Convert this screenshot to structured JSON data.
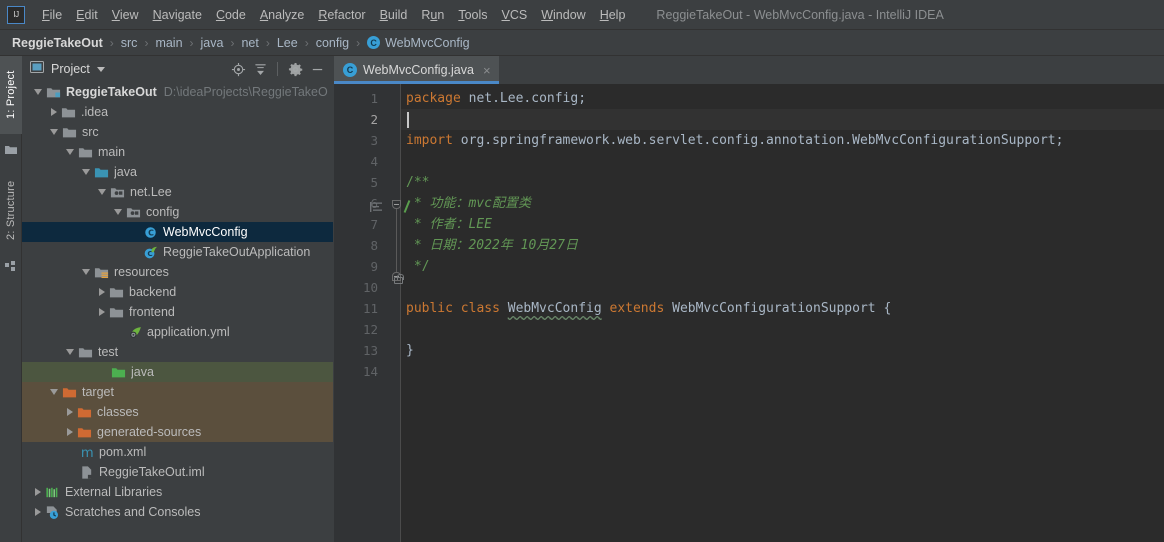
{
  "window": {
    "title": "ReggieTakeOut - WebMvcConfig.java - IntelliJ IDEA",
    "logo": "IJ"
  },
  "menubar": {
    "items": [
      {
        "label": "File",
        "mnemonic": "F"
      },
      {
        "label": "Edit",
        "mnemonic": "E"
      },
      {
        "label": "View",
        "mnemonic": "V"
      },
      {
        "label": "Navigate",
        "mnemonic": "N"
      },
      {
        "label": "Code",
        "mnemonic": "C"
      },
      {
        "label": "Analyze",
        "mnemonic": "A"
      },
      {
        "label": "Refactor",
        "mnemonic": "R"
      },
      {
        "label": "Build",
        "mnemonic": "B"
      },
      {
        "label": "Run",
        "mnemonic": "u"
      },
      {
        "label": "Tools",
        "mnemonic": "T"
      },
      {
        "label": "VCS",
        "mnemonic": "V"
      },
      {
        "label": "Window",
        "mnemonic": "W"
      },
      {
        "label": "Help",
        "mnemonic": "H"
      }
    ]
  },
  "breadcrumb": {
    "separator": "›",
    "items": [
      {
        "label": "ReggieTakeOut",
        "bold": true,
        "icon": ""
      },
      {
        "label": "src",
        "bold": false,
        "icon": ""
      },
      {
        "label": "main",
        "bold": false,
        "icon": ""
      },
      {
        "label": "java",
        "bold": false,
        "icon": ""
      },
      {
        "label": "net",
        "bold": false,
        "icon": ""
      },
      {
        "label": "Lee",
        "bold": false,
        "icon": ""
      },
      {
        "label": "config",
        "bold": false,
        "icon": ""
      },
      {
        "label": "WebMvcConfig",
        "bold": false,
        "icon": "class-icon"
      }
    ]
  },
  "toolstrip": {
    "buttons": [
      {
        "label": "1: Project",
        "number": "1",
        "active": true
      },
      {
        "label": "2: Structure",
        "number": "2",
        "active": false
      }
    ]
  },
  "project_panel": {
    "title": "Project",
    "actions": [
      {
        "name": "locate-icon",
        "glyph": "⊕"
      },
      {
        "name": "collapse-all-icon",
        "glyph": "≃"
      },
      {
        "name": "settings-gear-icon",
        "glyph": "⚙"
      },
      {
        "name": "hide-icon",
        "glyph": "—"
      }
    ],
    "tree": [
      {
        "label": "ReggieTakeOut",
        "path": "D:\\ideaProjects\\ReggieTakeO",
        "depth": 0,
        "twisty": "down",
        "icon": "project-folder",
        "bold": true,
        "state": "none"
      },
      {
        "label": ".idea",
        "path": "",
        "depth": 1,
        "twisty": "right",
        "icon": "folder",
        "bold": false,
        "state": "none"
      },
      {
        "label": "src",
        "path": "",
        "depth": 1,
        "twisty": "down",
        "icon": "folder",
        "bold": false,
        "state": "none"
      },
      {
        "label": "main",
        "path": "",
        "depth": 2,
        "twisty": "down",
        "icon": "folder",
        "bold": false,
        "state": "none"
      },
      {
        "label": "java",
        "path": "",
        "depth": 3,
        "twisty": "down",
        "icon": "source-folder",
        "bold": false,
        "state": "none"
      },
      {
        "label": "net.Lee",
        "path": "",
        "depth": 4,
        "twisty": "down",
        "icon": "package",
        "bold": false,
        "state": "none"
      },
      {
        "label": "config",
        "path": "",
        "depth": 5,
        "twisty": "down",
        "icon": "package",
        "bold": false,
        "state": "none"
      },
      {
        "label": "WebMvcConfig",
        "path": "",
        "depth": 6,
        "twisty": "blank",
        "icon": "class-icon",
        "bold": false,
        "state": "selected"
      },
      {
        "label": "ReggieTakeOutApplication",
        "path": "",
        "depth": 6,
        "twisty": "blank",
        "icon": "spring-class-icon",
        "bold": false,
        "state": "none"
      },
      {
        "label": "resources",
        "path": "",
        "depth": 3,
        "twisty": "down",
        "icon": "resource-folder",
        "bold": false,
        "state": "none"
      },
      {
        "label": "backend",
        "path": "",
        "depth": 4,
        "twisty": "right",
        "icon": "folder",
        "bold": false,
        "state": "none"
      },
      {
        "label": "frontend",
        "path": "",
        "depth": 4,
        "twisty": "right",
        "icon": "folder",
        "bold": false,
        "state": "none"
      },
      {
        "label": "application.yml",
        "path": "",
        "depth": 5,
        "twisty": "blank",
        "icon": "spring-yml-icon",
        "bold": false,
        "state": "none"
      },
      {
        "label": "test",
        "path": "",
        "depth": 2,
        "twisty": "down",
        "icon": "folder",
        "bold": false,
        "state": "none"
      },
      {
        "label": "java",
        "path": "",
        "depth": 4,
        "twisty": "blank",
        "icon": "test-source-folder",
        "bold": false,
        "state": "green"
      },
      {
        "label": "target",
        "path": "",
        "depth": 1,
        "twisty": "down",
        "icon": "excluded-folder",
        "bold": false,
        "state": "brown"
      },
      {
        "label": "classes",
        "path": "",
        "depth": 2,
        "twisty": "right",
        "icon": "excluded-folder",
        "bold": false,
        "state": "brown"
      },
      {
        "label": "generated-sources",
        "path": "",
        "depth": 2,
        "twisty": "right",
        "icon": "excluded-folder",
        "bold": false,
        "state": "brown"
      },
      {
        "label": "pom.xml",
        "path": "",
        "depth": 2,
        "twisty": "blank",
        "icon": "maven-icon",
        "bold": false,
        "state": "none"
      },
      {
        "label": "ReggieTakeOut.iml",
        "path": "",
        "depth": 2,
        "twisty": "blank",
        "icon": "iml-icon",
        "bold": false,
        "state": "none"
      },
      {
        "label": "External Libraries",
        "path": "",
        "depth": 0,
        "twisty": "right",
        "icon": "libraries-icon",
        "bold": false,
        "state": "none"
      },
      {
        "label": "Scratches and Consoles",
        "path": "",
        "depth": 0,
        "twisty": "right",
        "icon": "scratches-icon",
        "bold": false,
        "state": "none"
      }
    ]
  },
  "editor": {
    "tab": {
      "label": "WebMvcConfig.java",
      "icon": "class-icon",
      "close": "×"
    },
    "current_line": 2,
    "lines": [
      {
        "num": 1,
        "tokens": [
          {
            "t": "package ",
            "c": "kw"
          },
          {
            "t": "net.Lee.config;",
            "c": "pl"
          }
        ]
      },
      {
        "num": 2,
        "tokens": []
      },
      {
        "num": 3,
        "tokens": [
          {
            "t": "import ",
            "c": "kw"
          },
          {
            "t": "org.springframework.web.servlet.config.annotation.WebMvcConfigurationSupport;",
            "c": "pl"
          }
        ]
      },
      {
        "num": 4,
        "tokens": []
      },
      {
        "num": 5,
        "tokens": [
          {
            "t": "/**",
            "c": "cm-b"
          }
        ]
      },
      {
        "num": 6,
        "tokens": [
          {
            "t": " * 功能：mvc配置类",
            "c": "cm"
          }
        ]
      },
      {
        "num": 7,
        "tokens": [
          {
            "t": " * 作者：LEE",
            "c": "cm"
          }
        ]
      },
      {
        "num": 8,
        "tokens": [
          {
            "t": " * 日期：2022年 10月27日",
            "c": "cm"
          }
        ]
      },
      {
        "num": 9,
        "tokens": [
          {
            "t": " */",
            "c": "cm-b"
          }
        ]
      },
      {
        "num": 10,
        "tokens": []
      },
      {
        "num": 11,
        "tokens": [
          {
            "t": "public class ",
            "c": "kw"
          },
          {
            "t": "WebMvcConfig",
            "c": "cls-warn"
          },
          {
            "t": " ",
            "c": "pl"
          },
          {
            "t": "extends ",
            "c": "kw"
          },
          {
            "t": "WebMvcConfigurationSupport {",
            "c": "pl"
          }
        ]
      },
      {
        "num": 12,
        "tokens": []
      },
      {
        "num": 13,
        "tokens": [
          {
            "t": "}",
            "c": "pl"
          }
        ]
      },
      {
        "num": 14,
        "tokens": []
      }
    ]
  },
  "colors": {
    "bg_panel": "#3c3f41",
    "bg_editor": "#2b2b2b",
    "bg_gutter": "#313335",
    "accent": "#4a88c7",
    "selection": "#0d293e",
    "text": "#a9b7c6",
    "keyword": "#cc7832",
    "comment": "#629755",
    "green_row": "#4c5640",
    "brown_row": "#5b4f3d"
  }
}
